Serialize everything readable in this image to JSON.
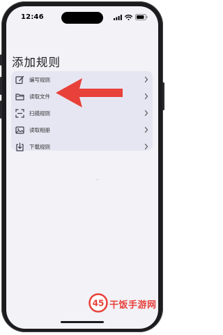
{
  "status_bar": {
    "time": "12:46"
  },
  "page": {
    "title": "添加规则"
  },
  "menu": {
    "items": [
      {
        "label": "编写规则",
        "icon": "edit-icon"
      },
      {
        "label": "读取文件",
        "icon": "folder-icon"
      },
      {
        "label": "扫描规则",
        "icon": "scan-icon"
      },
      {
        "label": "读取相册",
        "icon": "photo-icon"
      },
      {
        "label": "下载规则",
        "icon": "download-icon"
      }
    ]
  },
  "annotation": {
    "arrow_color": "#e8413a",
    "points_to": "读取文件"
  },
  "watermark": {
    "logo_text": "45",
    "text": "干饭手游网"
  },
  "colors": {
    "screen_bg": "#f2f2f7",
    "card_bg": "#e6e6f2",
    "icon_color": "#3a3a48",
    "brand_red": "#e8413a"
  }
}
